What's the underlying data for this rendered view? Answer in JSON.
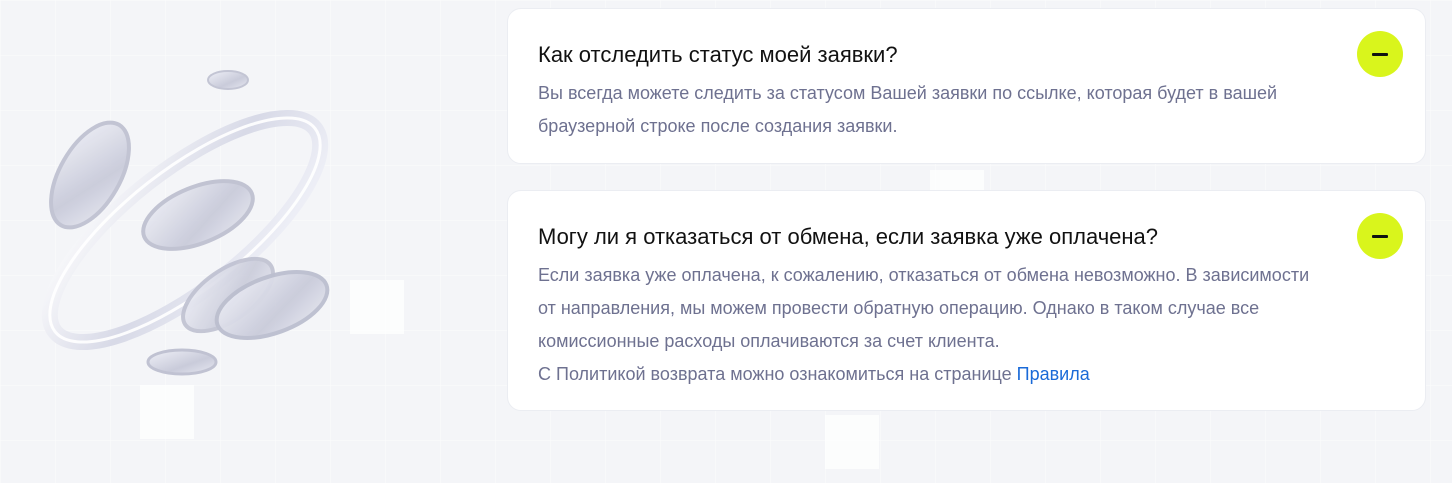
{
  "colors": {
    "background": "#f4f5f8",
    "card": "#ffffff",
    "accent": "#d9f51c",
    "question_text": "#111111",
    "answer_text": "#6e7190",
    "link": "#1a6ad8"
  },
  "illustration": {
    "icon": "glass-ring-and-coins"
  },
  "faq": {
    "items": [
      {
        "question": "Как отследить статус моей заявки?",
        "expanded": true,
        "toggle_icon": "minus-icon",
        "answer_lines": [
          "Вы всегда можете следить за статусом Вашей заявки по ссылке, которая будет в вашей браузерной строке после создания заявки."
        ]
      },
      {
        "question": "Могу ли я отказаться от обмена, если заявка уже оплачена?",
        "expanded": true,
        "toggle_icon": "minus-icon",
        "answer_lines": [
          "Если заявка уже оплачена, к сожалению, отказаться от обмена невозможно. В зависимости от направления, мы можем провести обратную операцию. Однако в таком случае все комиссионные расходы оплачиваются за счет клиента."
        ],
        "policy_text": "С Политикой возврата можно ознакомиться на странице",
        "policy_link_label": "Правила"
      }
    ]
  }
}
